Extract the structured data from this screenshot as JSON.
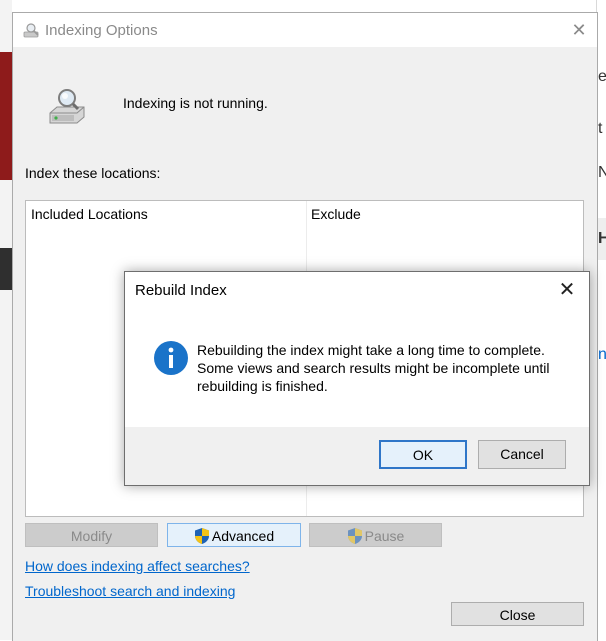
{
  "main_dialog": {
    "title": "Indexing Options",
    "close_glyph": "✕",
    "status_text": "Indexing is not running.",
    "locations_label": "Index these locations:",
    "table": {
      "columns": [
        "Included Locations",
        "Exclude"
      ],
      "rows": []
    },
    "buttons": {
      "modify": "Modify",
      "advanced": "Advanced",
      "pause": "Pause",
      "close": "Close"
    },
    "links": {
      "how_indexing": "How does indexing affect searches?",
      "troubleshoot": "Troubleshoot search and indexing"
    }
  },
  "rebuild_dialog": {
    "title": "Rebuild Index",
    "close_glyph": "✕",
    "message_lines": [
      "Rebuilding the index might take a long time to complete.",
      "Some views and search results might be incomplete until",
      "rebuilding is finished."
    ],
    "buttons": {
      "ok": "OK",
      "cancel": "Cancel"
    }
  },
  "background_glyphs": [
    "e",
    "t",
    "N",
    "H",
    "n"
  ],
  "icons": {
    "title": "indexing-options-icon",
    "status": "magnifier-drive-icon",
    "info": "info-icon",
    "shield": "uac-shield-icon"
  },
  "colors": {
    "link": "#0066cc",
    "info_blue": "#1a73c9",
    "focus_border": "#2f76c8"
  }
}
